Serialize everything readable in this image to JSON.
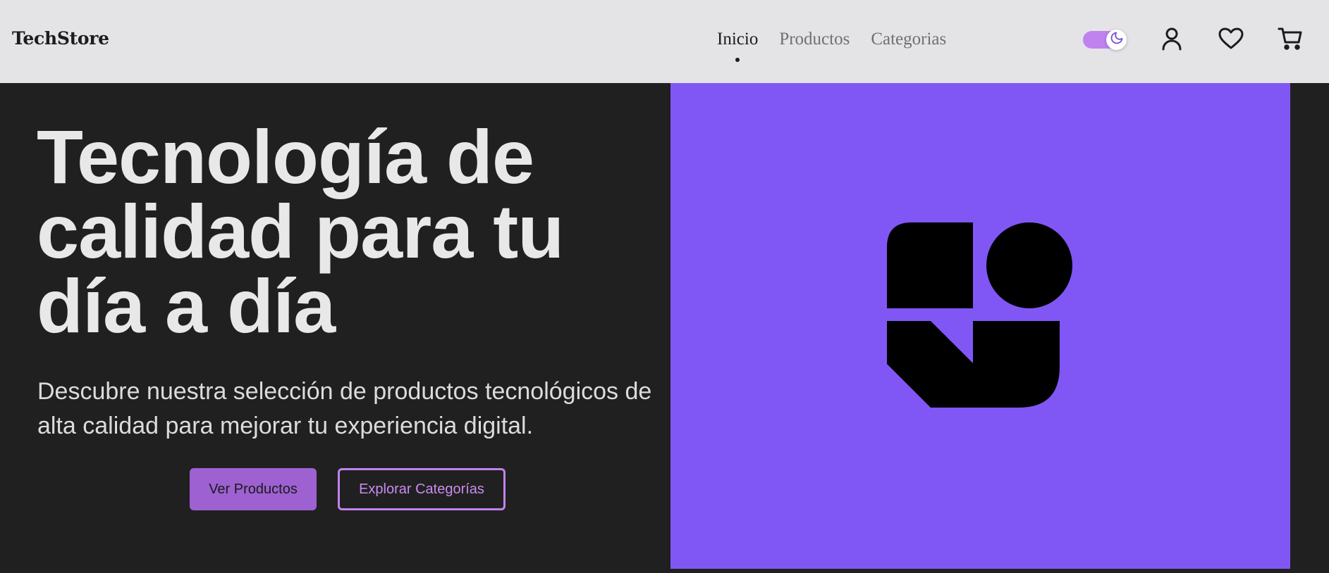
{
  "header": {
    "brand": "TechStore",
    "nav": [
      {
        "label": "Inicio",
        "active": true
      },
      {
        "label": "Productos",
        "active": false
      },
      {
        "label": "Categorias",
        "active": false
      }
    ],
    "theme_toggle": {
      "state": "dark",
      "icon": "moon-icon"
    },
    "icons": [
      "user-icon",
      "heart-icon",
      "cart-icon"
    ]
  },
  "hero": {
    "title": "Tecnología de calidad para tu día a día",
    "subtitle": "Descubre nuestra selección de productos tecnológicos de alta calidad para mejorar tu experiencia digital.",
    "primary_button": "Ver Productos",
    "secondary_button": "Explorar Categorías",
    "image_bg_color": "#8057f5",
    "logo_color": "#000000"
  },
  "colors": {
    "header_bg": "#e4e4e7",
    "page_bg": "#202020",
    "accent": "#9e61d2",
    "accent_light": "#c182ef"
  }
}
